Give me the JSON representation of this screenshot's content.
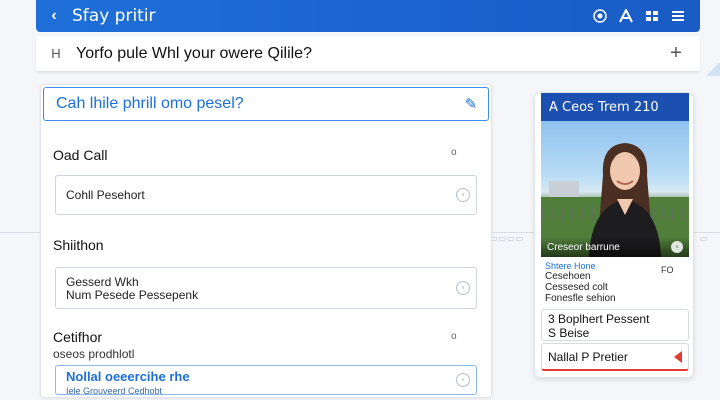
{
  "appbar": {
    "back_icon": "back-arrow-icon",
    "title": "Sfay pritir",
    "right_icons": [
      "target-icon",
      "a-icon",
      "grid-icon",
      "menu-icon"
    ]
  },
  "question": {
    "hash": "H",
    "text": "Yorfo pule Whl your owere Qilile?",
    "plus": "+"
  },
  "form": {
    "prompt": "Cah lhile phrill omo pesel?",
    "section1": {
      "label": "Oad Call",
      "field_text": "Cohll Pesehort"
    },
    "section2": {
      "label": "Shiithon",
      "field_line1": "Gesserd Wkh",
      "field_line2": "Num Pesede Pessepenk"
    },
    "section3": {
      "label": "Cetifhor",
      "sublabel": "oseos prodhlotl",
      "field_main": "Nollal oeeercihe rhe",
      "field_sub": "Iele Grouveerd Cedhobt"
    },
    "accent_color": "#1b6fd6"
  },
  "profile_card": {
    "header": "A Ceos Trem 210",
    "photo_caption": "Creseor barrune",
    "photo_caption_sub": "Shtere Hone",
    "flag": "FO",
    "meta_line1": "Cesehoen",
    "meta_line2": "Cessesed colt",
    "meta_line3": "Fonesfle sehion",
    "box1_line1": "3 Boplhert Pessent",
    "box1_line2": "S Beise",
    "box2_text": "Nallal P Pretier",
    "alert_color": "#e53935"
  }
}
